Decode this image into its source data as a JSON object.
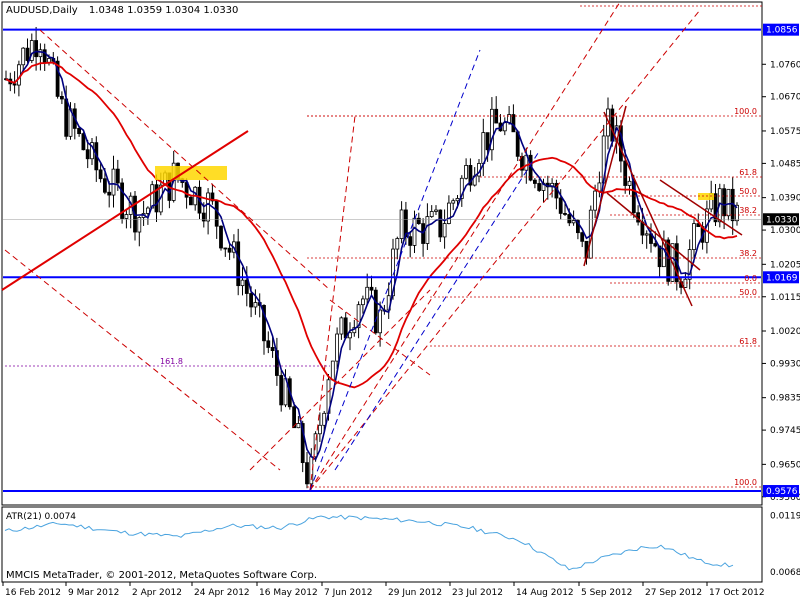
{
  "chart_data": {
    "type": "candlestick",
    "header": {
      "symbol_label": "AUDUSD,Daily",
      "ohlc": "1.0348 1.0359 1.0304 1.0330"
    },
    "price_axis": {
      "ylim": [
        0.954,
        1.093
      ],
      "ticks": [
        "1.0760",
        "1.0670",
        "1.0575",
        "1.0485",
        "1.0390",
        "1.0300",
        "1.0205",
        "1.0115",
        "1.0020",
        "0.9930",
        "0.9835",
        "0.9745",
        "0.9650",
        "0.9560"
      ],
      "markers": [
        {
          "label": "1.0856",
          "value": 1.0856,
          "color": "#0000ff"
        },
        {
          "label": "1.0330",
          "value": 1.033,
          "color": "#000000"
        },
        {
          "label": "1.0169",
          "value": 1.0169,
          "color": "#0000ff"
        },
        {
          "label": "0.9576",
          "value": 0.9576,
          "color": "#0000ff"
        }
      ]
    },
    "time_axis": {
      "labels": [
        "16 Feb 2012",
        "9 Mar 2012",
        "2 Apr 2012",
        "24 Apr 2012",
        "16 May 2012",
        "7 Jun 2012",
        "29 Jun 2012",
        "23 Jul 2012",
        "14 Aug 2012",
        "5 Sep 2012",
        "27 Sep 2012",
        "17 Oct 2012"
      ]
    },
    "horizontal_lines": [
      {
        "value": 1.0856,
        "color": "#0000ff"
      },
      {
        "value": 1.0169,
        "color": "#0000ff"
      },
      {
        "value": 0.9576,
        "color": "#0000ff"
      }
    ],
    "fibonacci_labels": [
      "100.0",
      "61.8",
      "50.0",
      "38.2",
      "0.0",
      "50.0",
      "61.8",
      "100.0",
      "38.2",
      "161.8"
    ],
    "atr_panel": {
      "label": "ATR(21) 0.0074",
      "ticks": [
        "0.0119",
        "0.0068"
      ],
      "ylim": [
        0.006,
        0.0125
      ]
    },
    "footer_text": "MMCIS MetaTrader, © 2001-2012, MetaQuotes Software Corp.",
    "colors": {
      "up_candle": "#000000",
      "down_candle": "#000000",
      "ma_fast": "#00007f",
      "ma_slow": "#e00000",
      "support_line": "#0000ff",
      "fib_lines": "#cc0000",
      "atr_line": "#4aa3df",
      "highlight_box": "#ffd700"
    }
  }
}
